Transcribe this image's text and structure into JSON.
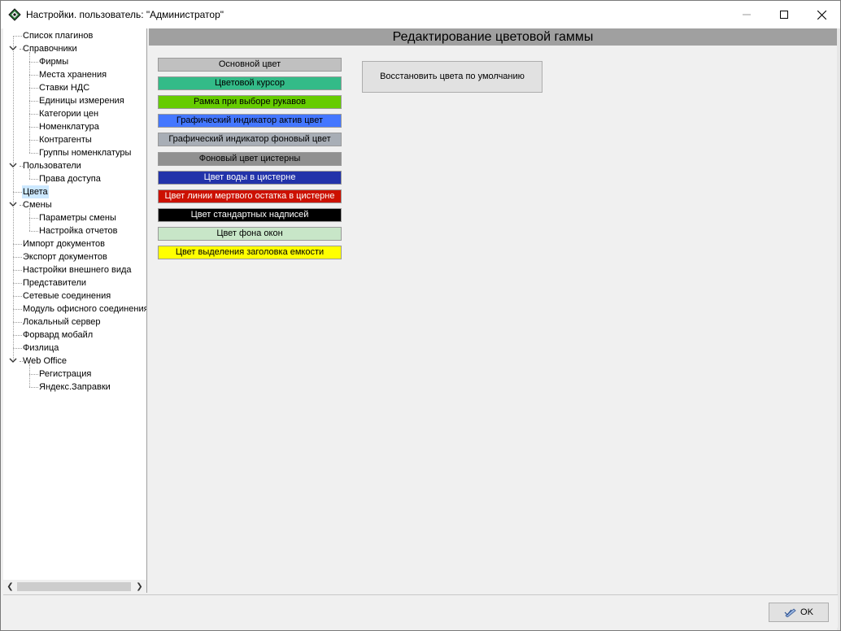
{
  "window": {
    "title": "Настройки. пользователь: \"Администратор\""
  },
  "tree": {
    "items": [
      {
        "label": "Список плагинов",
        "level": 0,
        "expanded": null,
        "selected": false
      },
      {
        "label": "Справочники",
        "level": 0,
        "expanded": true,
        "selected": false
      },
      {
        "label": "Фирмы",
        "level": 1,
        "expanded": null,
        "selected": false
      },
      {
        "label": "Места хранения",
        "level": 1,
        "expanded": null,
        "selected": false
      },
      {
        "label": "Ставки НДС",
        "level": 1,
        "expanded": null,
        "selected": false
      },
      {
        "label": "Единицы измерения",
        "level": 1,
        "expanded": null,
        "selected": false
      },
      {
        "label": "Категории цен",
        "level": 1,
        "expanded": null,
        "selected": false
      },
      {
        "label": "Номенклатура",
        "level": 1,
        "expanded": null,
        "selected": false
      },
      {
        "label": "Контрагенты",
        "level": 1,
        "expanded": null,
        "selected": false
      },
      {
        "label": "Группы номенклатуры",
        "level": 1,
        "expanded": null,
        "selected": false
      },
      {
        "label": "Пользователи",
        "level": 0,
        "expanded": true,
        "selected": false
      },
      {
        "label": "Права доступа",
        "level": 1,
        "expanded": null,
        "selected": false
      },
      {
        "label": "Цвета",
        "level": 0,
        "expanded": null,
        "selected": true
      },
      {
        "label": "Смены",
        "level": 0,
        "expanded": true,
        "selected": false
      },
      {
        "label": "Параметры смены",
        "level": 1,
        "expanded": null,
        "selected": false
      },
      {
        "label": "Настройка отчетов",
        "level": 1,
        "expanded": null,
        "selected": false
      },
      {
        "label": "Импорт документов",
        "level": 0,
        "expanded": null,
        "selected": false
      },
      {
        "label": "Экспорт документов",
        "level": 0,
        "expanded": null,
        "selected": false
      },
      {
        "label": "Настройки внешнего вида",
        "level": 0,
        "expanded": null,
        "selected": false
      },
      {
        "label": "Представители",
        "level": 0,
        "expanded": null,
        "selected": false
      },
      {
        "label": "Сетевые соединения",
        "level": 0,
        "expanded": null,
        "selected": false
      },
      {
        "label": "Модуль офисного соединения",
        "level": 0,
        "expanded": null,
        "selected": false
      },
      {
        "label": "Локальный сервер",
        "level": 0,
        "expanded": null,
        "selected": false
      },
      {
        "label": "Форвард мобайл",
        "level": 0,
        "expanded": null,
        "selected": false
      },
      {
        "label": "Физлица",
        "level": 0,
        "expanded": null,
        "selected": false
      },
      {
        "label": "Web Office",
        "level": 0,
        "expanded": true,
        "selected": false
      },
      {
        "label": "Регистрация",
        "level": 1,
        "expanded": null,
        "selected": false
      },
      {
        "label": "Яндекс.Заправки",
        "level": 1,
        "expanded": null,
        "selected": false
      }
    ]
  },
  "main": {
    "header": "Редактирование цветовой гаммы",
    "restore_button": "Восстановить цвета по умолчанию",
    "color_buttons": [
      {
        "label": "Основной цвет",
        "bg": "#c0c0c0",
        "fg": "#000000"
      },
      {
        "label": "Цветовой курсор",
        "bg": "#33bb88",
        "fg": "#000000"
      },
      {
        "label": "Рамка при выборе рукавов",
        "bg": "#66cc00",
        "fg": "#000000"
      },
      {
        "label": "Графический индикатор актив цвет",
        "bg": "#4477ff",
        "fg": "#000000"
      },
      {
        "label": "Графический индикатор фоновый цвет",
        "bg": "#a8aeb6",
        "fg": "#000000"
      },
      {
        "label": "Фоновый цвет цистерны",
        "bg": "#909090",
        "fg": "#000000"
      },
      {
        "label": "Цвет воды в цистерне",
        "bg": "#2233aa",
        "fg": "#ffffff"
      },
      {
        "label": "Цвет линии мертвого остатка в цистерне",
        "bg": "#cc1100",
        "fg": "#ffffff"
      },
      {
        "label": "Цвет стандартных надписей",
        "bg": "#000000",
        "fg": "#ffffff"
      },
      {
        "label": "Цвет фона окон",
        "bg": "#c8e6c8",
        "fg": "#000000"
      },
      {
        "label": "Цвет выделения заголовка емкости",
        "bg": "#ffff00",
        "fg": "#000000"
      }
    ]
  },
  "footer": {
    "ok_label": "OK"
  }
}
